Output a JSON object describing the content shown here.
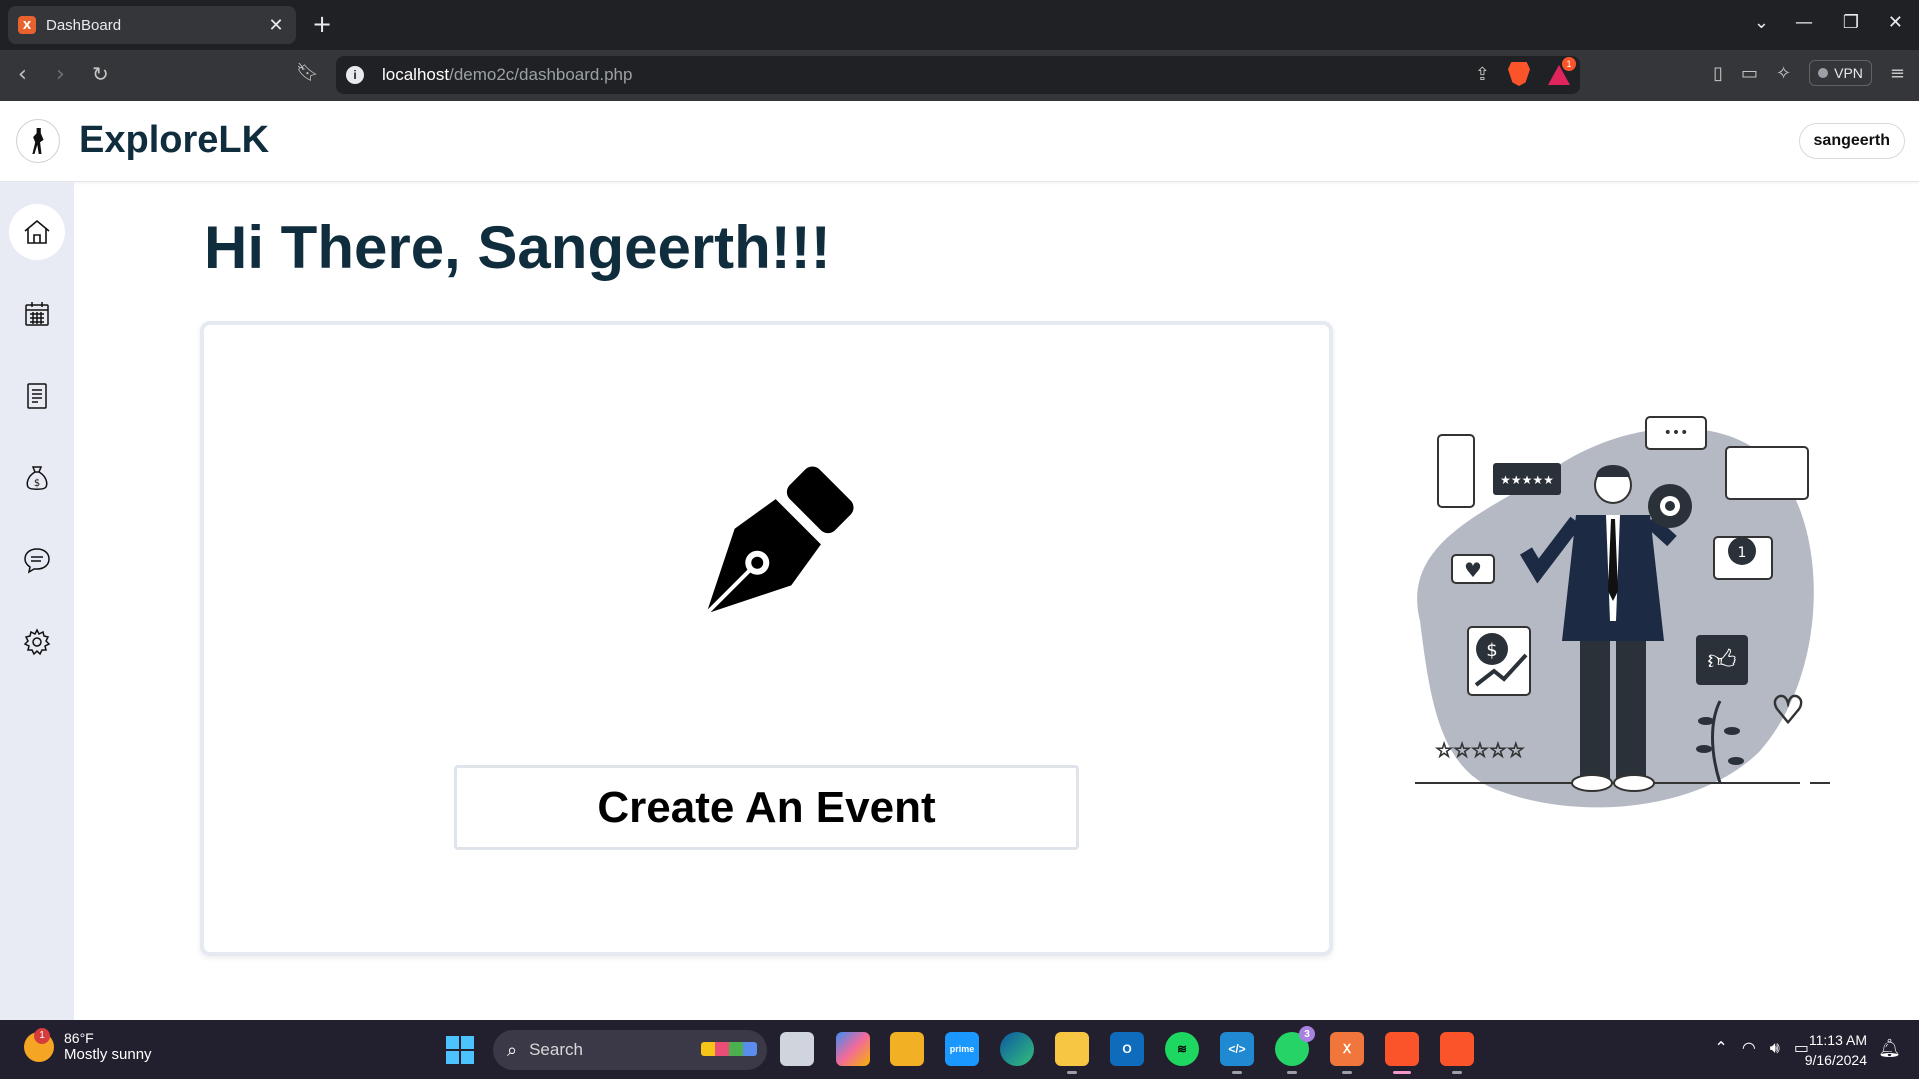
{
  "browser": {
    "tab_title": "DashBoard",
    "tab_favicon": "xampp-icon",
    "url_host": "localhost",
    "url_path": "/demo2c/dashboard.php",
    "brave_rewards_badge": "1",
    "vpn_label": "VPN"
  },
  "app": {
    "brand": "ExploreLK",
    "user": "sangeerth",
    "greeting": "Hi There, Sangeerth!!!",
    "create_button": "Create An Event",
    "sidebar": [
      {
        "name": "home",
        "icon": "home-icon",
        "active": true
      },
      {
        "name": "calendar",
        "icon": "calendar-icon",
        "active": false
      },
      {
        "name": "documents",
        "icon": "document-icon",
        "active": false
      },
      {
        "name": "budget",
        "icon": "money-bag-icon",
        "active": false
      },
      {
        "name": "messages",
        "icon": "chat-icon",
        "active": false
      },
      {
        "name": "settings",
        "icon": "gear-icon",
        "active": false
      }
    ]
  },
  "taskbar": {
    "weather_temp": "86°F",
    "weather_desc": "Mostly sunny",
    "weather_badge": "1",
    "search_label": "Search",
    "whatsapp_badge": "3",
    "time": "11:13 AM",
    "date": "9/16/2024"
  }
}
